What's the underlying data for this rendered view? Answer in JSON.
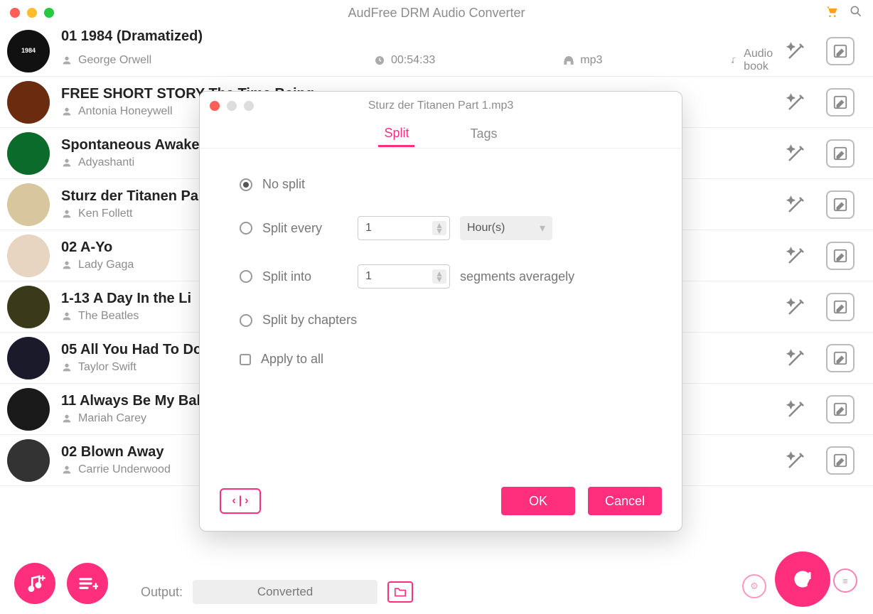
{
  "app_title": "AudFree DRM Audio Converter",
  "tracks": [
    {
      "title": "01 1984 (Dramatized)",
      "artist": "George Orwell",
      "duration": "00:54:33",
      "format": "mp3",
      "type": "Audio book",
      "cover_tag": "1984"
    },
    {
      "title": "FREE SHORT STORY The Time Being...",
      "artist": "Antonia Honeywell"
    },
    {
      "title": "Spontaneous Awake",
      "artist": "Adyashanti"
    },
    {
      "title": "Sturz der Titanen Pa",
      "artist": "Ken Follett"
    },
    {
      "title": "02 A-Yo",
      "artist": "Lady Gaga"
    },
    {
      "title": "1-13 A Day In the Li",
      "artist": "The Beatles"
    },
    {
      "title": "05 All You Had To Do",
      "artist": "Taylor Swift"
    },
    {
      "title": "11 Always Be My Bal",
      "artist": "Mariah Carey"
    },
    {
      "title": "02 Blown Away",
      "artist": "Carrie Underwood"
    }
  ],
  "output": {
    "label": "Output:",
    "value": "Converted"
  },
  "dialog": {
    "filename": "Sturz der Titanen Part 1.mp3",
    "tabs": {
      "split": "Split",
      "tags": "Tags"
    },
    "options": {
      "no_split": "No split",
      "split_every": "Split every",
      "split_every_value": "1",
      "split_every_unit": "Hour(s)",
      "split_into": "Split into",
      "split_into_value": "1",
      "split_into_suffix": "segments averagely",
      "split_chapters": "Split by chapters",
      "apply_all": "Apply to all"
    },
    "buttons": {
      "ok": "OK",
      "cancel": "Cancel"
    }
  }
}
